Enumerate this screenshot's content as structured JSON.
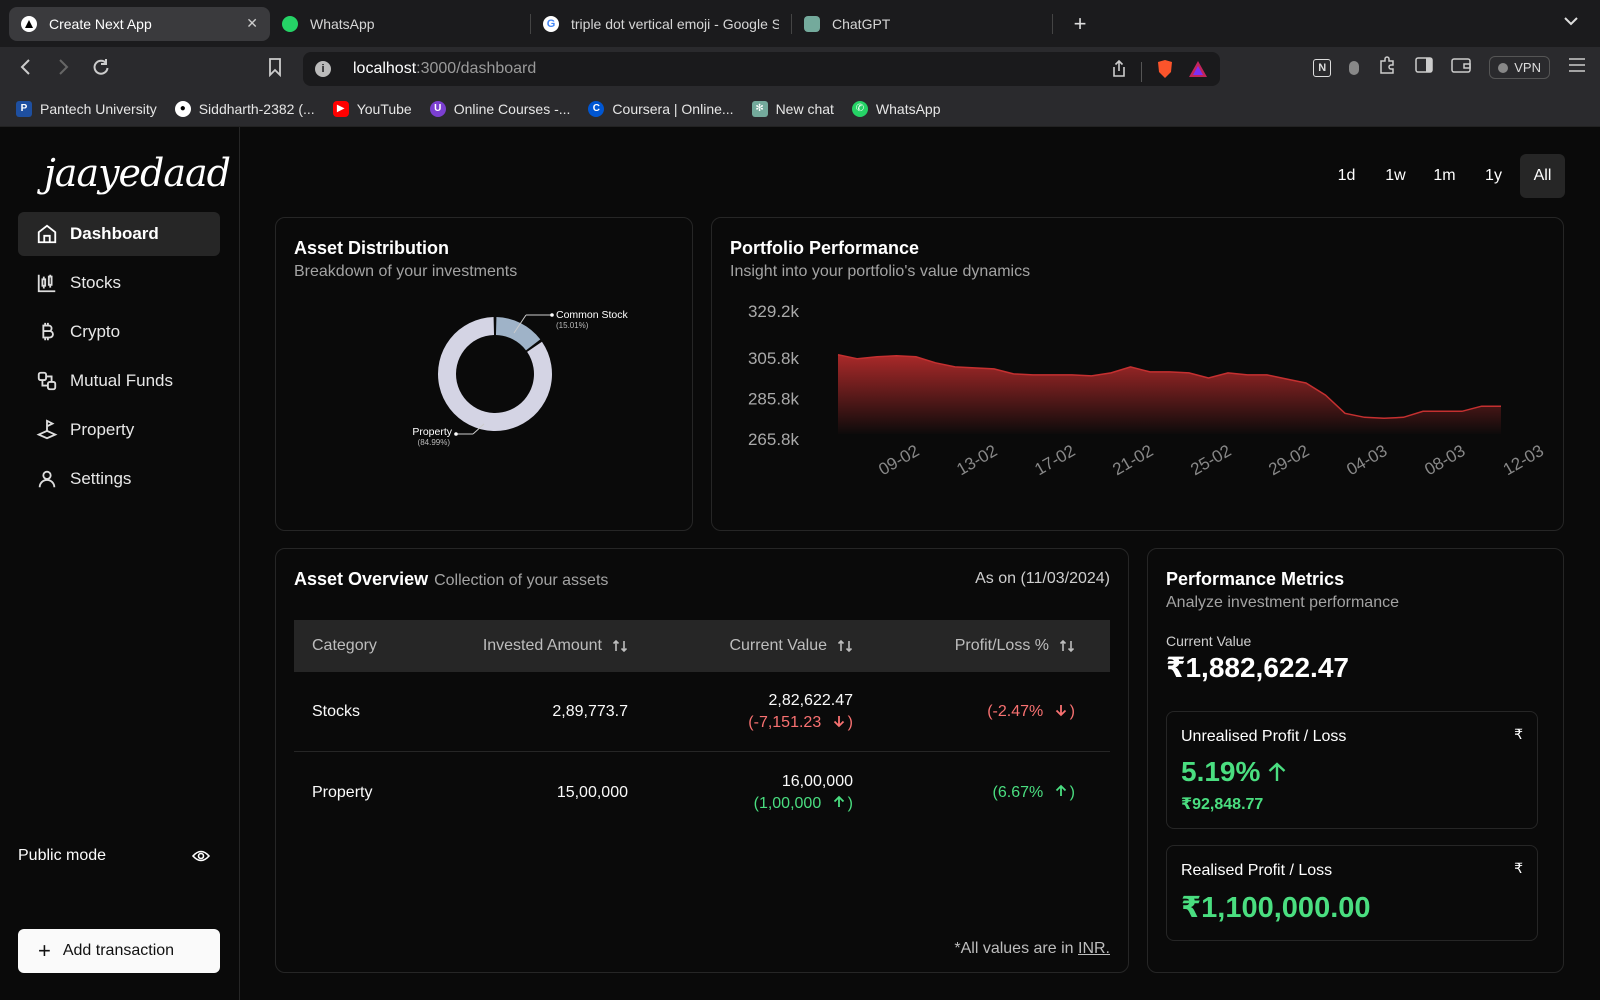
{
  "browser": {
    "tabs": [
      {
        "title": "Create Next App"
      },
      {
        "title": "WhatsApp"
      },
      {
        "title": "triple dot vertical emoji - Google S"
      },
      {
        "title": "ChatGPT"
      }
    ],
    "address": {
      "host": "localhost",
      "path": ":3000/dashboard"
    },
    "vpn_label": "VPN",
    "bookmarks": [
      {
        "label": "Pantech University"
      },
      {
        "label": "Siddharth-2382 (..."
      },
      {
        "label": "YouTube"
      },
      {
        "label": "Online Courses -..."
      },
      {
        "label": "Coursera | Online..."
      },
      {
        "label": "New chat"
      },
      {
        "label": "WhatsApp"
      }
    ]
  },
  "sidebar": {
    "logo": "jaayedaad",
    "items": [
      {
        "label": "Dashboard",
        "icon": "home-icon"
      },
      {
        "label": "Stocks",
        "icon": "candlestick-icon"
      },
      {
        "label": "Crypto",
        "icon": "bitcoin-icon"
      },
      {
        "label": "Mutual Funds",
        "icon": "funds-icon"
      },
      {
        "label": "Property",
        "icon": "land-plot-icon"
      },
      {
        "label": "Settings",
        "icon": "user-icon"
      }
    ],
    "public_mode_label": "Public mode",
    "add_transaction_label": "Add transaction"
  },
  "ranges": [
    "1d",
    "1w",
    "1m",
    "1y",
    "All"
  ],
  "active_range": "All",
  "asset_distribution": {
    "title": "Asset Distribution",
    "subtitle": "Breakdown of your investments",
    "slices": [
      {
        "name": "Common Stock",
        "pct_label": "(15.01%)",
        "value": 15.01,
        "color": "#9fb3c8"
      },
      {
        "name": "Property",
        "pct_label": "(84.99%)",
        "value": 84.99,
        "color": "#d4d4e4"
      }
    ]
  },
  "portfolio_performance": {
    "title": "Portfolio Performance",
    "subtitle": "Insight into your portfolio's value dynamics"
  },
  "chart_data": {
    "type": "area",
    "title": "Portfolio Performance",
    "x_ticks": [
      "09-02",
      "13-02",
      "17-02",
      "21-02",
      "25-02",
      "29-02",
      "04-03",
      "08-03",
      "12-03"
    ],
    "y_ticks": [
      "329.2k",
      "305.8k",
      "285.8k",
      "265.8k"
    ],
    "ylim": [
      265800,
      329200
    ],
    "series": [
      {
        "x": [
          "06-02",
          "07-02",
          "08-02",
          "09-02",
          "10-02",
          "11-02",
          "12-02",
          "13-02",
          "14-02",
          "15-02",
          "16-02",
          "17-02",
          "18-02",
          "19-02",
          "20-02",
          "21-02",
          "22-02",
          "23-02",
          "24-02",
          "25-02",
          "26-02",
          "27-02",
          "28-02",
          "29-02",
          "01-03",
          "02-03",
          "03-03",
          "04-03",
          "05-03",
          "06-03",
          "07-03",
          "08-03",
          "09-03",
          "10-03",
          "11-03"
        ],
        "values": [
          311000,
          309000,
          310000,
          310500,
          310000,
          307000,
          305000,
          304500,
          304000,
          301500,
          301000,
          301000,
          301000,
          300500,
          302000,
          305000,
          302500,
          302500,
          302000,
          299500,
          302000,
          301000,
          301000,
          299000,
          297000,
          291000,
          282000,
          280000,
          279500,
          280000,
          283000,
          283000,
          283000,
          285500,
          285500
        ]
      }
    ]
  },
  "asset_overview": {
    "title": "Asset Overview",
    "subtitle": "Collection of your assets",
    "as_on": "As on (11/03/2024)",
    "columns": [
      "Category",
      "Invested Amount",
      "Current Value",
      "Profit/Loss %"
    ],
    "rows": [
      {
        "category": "Stocks",
        "invested": "2,89,773.7",
        "current": "2,82,622.47",
        "delta": "(-7,151.23",
        "pl": "(-2.47%",
        "trend": "down"
      },
      {
        "category": "Property",
        "invested": "15,00,000",
        "current": "16,00,000",
        "delta": "(1,00,000",
        "pl": "(6.67%",
        "trend": "up"
      }
    ],
    "footnote_prefix": "*All values are in ",
    "footnote_currency": "INR."
  },
  "performance_metrics": {
    "title": "Performance Metrics",
    "subtitle": "Analyze investment performance",
    "current_value_label": "Current Value",
    "current_value": "₹1,882,622.47",
    "unrealised_label": "Unrealised Profit / Loss",
    "unrealised_pct": "5.19%",
    "unrealised_amount": "₹92,848.77",
    "realised_label": "Realised Profit / Loss",
    "realised_amount": "₹1,100,000.00",
    "currency_symbol": "₹"
  }
}
